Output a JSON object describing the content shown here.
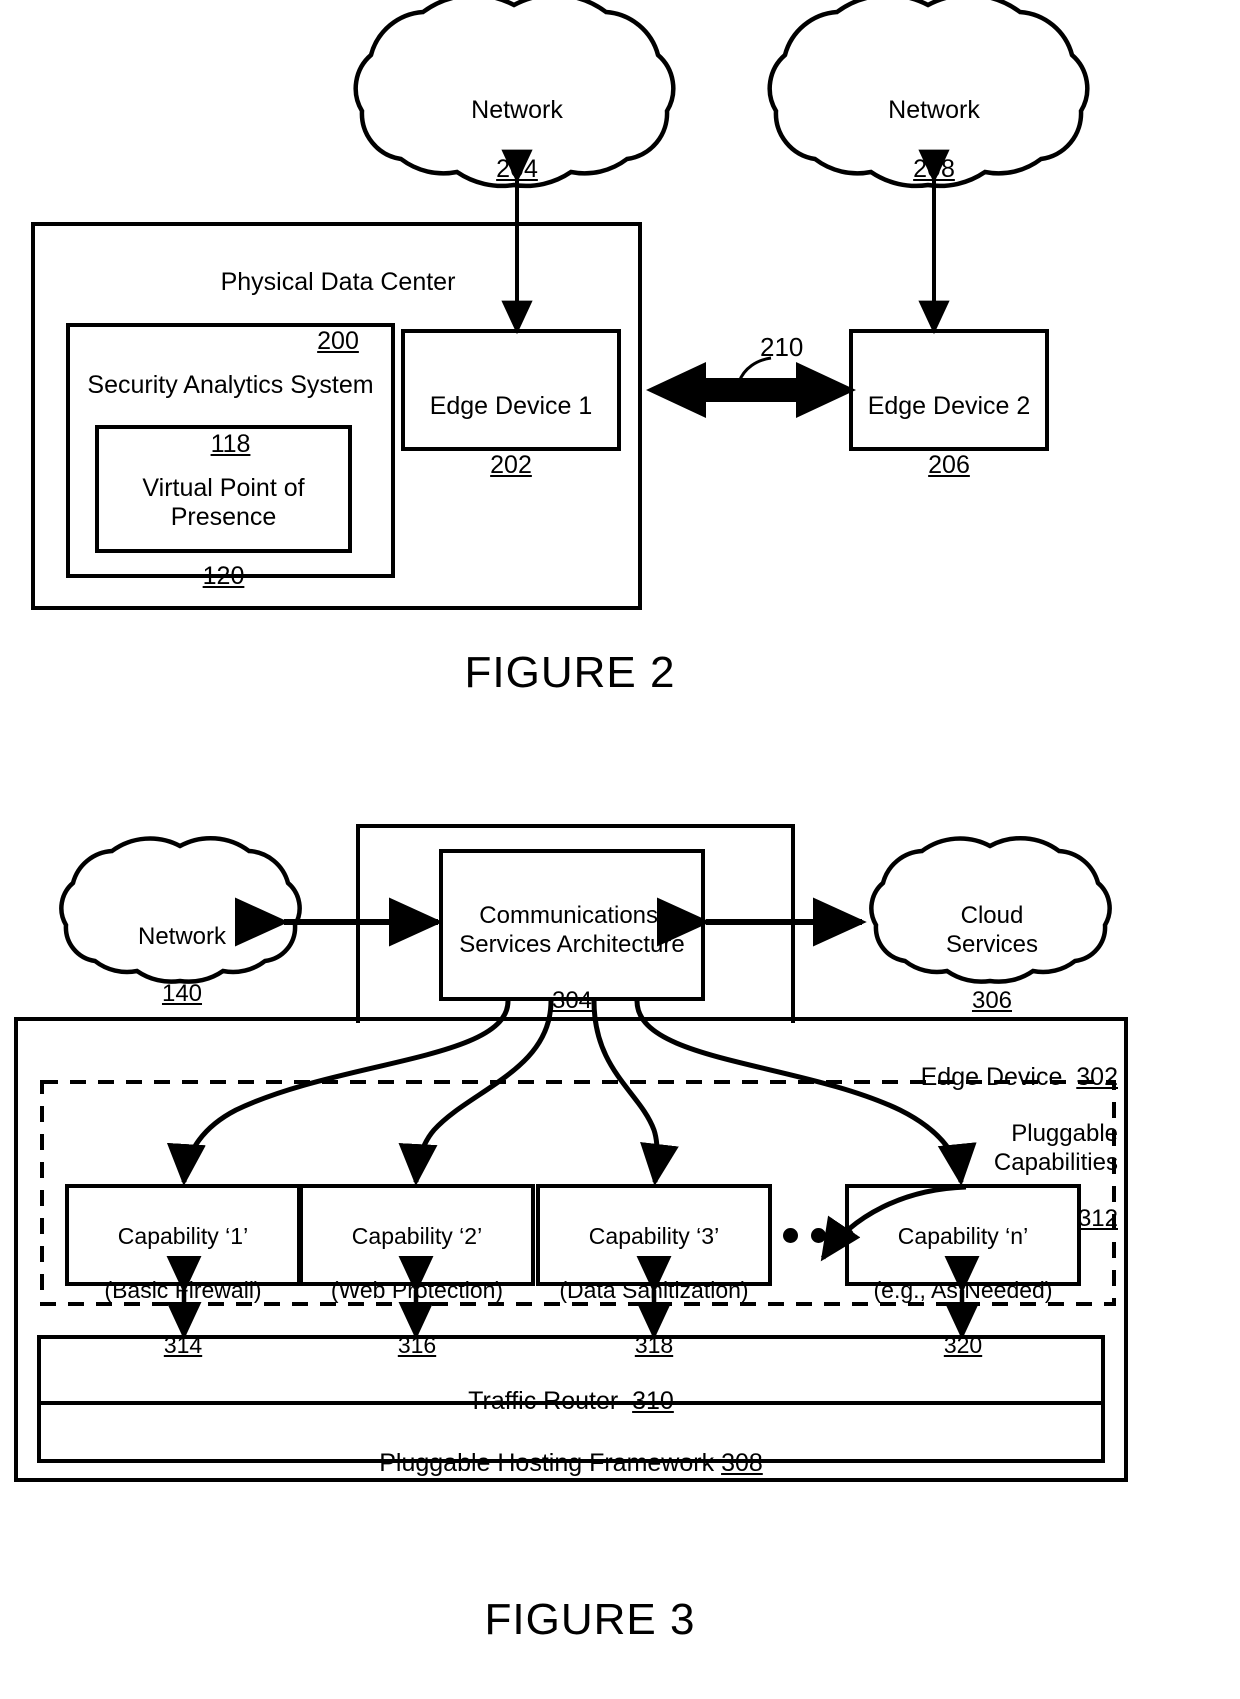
{
  "figure2": {
    "caption": "FIGURE 2",
    "network_left": {
      "name": "Network",
      "ref": "204"
    },
    "network_right": {
      "name": "Network",
      "ref": "208"
    },
    "data_center": {
      "name": "Physical Data Center",
      "ref": "200"
    },
    "security_analytics": {
      "name": "Security Analytics System",
      "ref": "118"
    },
    "virtual_pop": {
      "name": "Virtual Point of\nPresence",
      "ref": "120"
    },
    "edge_device_1": {
      "name": "Edge Device 1",
      "ref": "202"
    },
    "edge_device_2": {
      "name": "Edge Device 2",
      "ref": "206"
    },
    "link_label": "210"
  },
  "figure3": {
    "caption": "FIGURE 3",
    "network": {
      "name": "Network",
      "ref": "140"
    },
    "cloud_services": {
      "name": "Cloud\nServices",
      "ref": "306"
    },
    "comms_arch": {
      "name": "Communications/\nServices Architecture",
      "ref": "304"
    },
    "edge_device": {
      "name": "Edge Device",
      "ref": "302"
    },
    "pluggable_capabilities": {
      "name": "Pluggable\nCapabilities",
      "ref": "312"
    },
    "capabilities": [
      {
        "title": "Capability ‘1’",
        "subtitle": "(Basic Firewall)",
        "ref": "314"
      },
      {
        "title": "Capability ‘2’",
        "subtitle": "(Web Protection)",
        "ref": "316"
      },
      {
        "title": "Capability ‘3’",
        "subtitle": "(Data Sanitization)",
        "ref": "318"
      },
      {
        "title": "Capability ‘n’",
        "subtitle": "(e.g., As Needed)",
        "ref": "320"
      }
    ],
    "ellipsis_dots": 3,
    "traffic_router": {
      "name": "Traffic Router",
      "ref": "310"
    },
    "hosting_framework": {
      "name": "Pluggable Hosting Framework",
      "ref": "308"
    }
  },
  "colors": {
    "ink": "#000000",
    "paper": "#ffffff"
  }
}
